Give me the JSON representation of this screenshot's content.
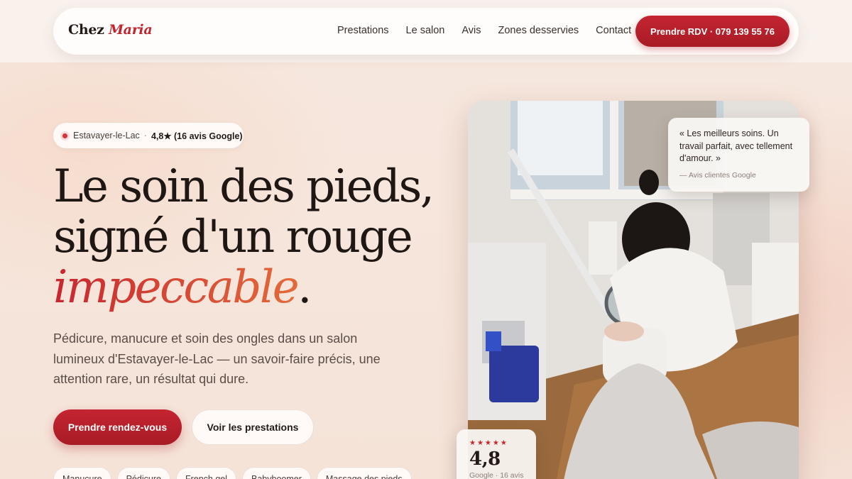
{
  "nav": {
    "brand_prefix": "Chez",
    "brand_name": "Maria",
    "links": [
      "Prestations",
      "Le salon",
      "Avis",
      "Zones desservies",
      "Contact"
    ],
    "cta_label": "Prendre RDV · 079 139 55 76"
  },
  "hero": {
    "badge": {
      "location": "Estavayer-le-Lac",
      "separator": "·",
      "rating": "4,8★ (16 avis Google)"
    },
    "headline_line1": "Le soin des pieds,",
    "headline_line2": "signé d'un rouge",
    "headline_accent": "impeccable",
    "headline_end": ".",
    "lede": "Pédicure, manucure et soin des ongles dans un salon lumineux d'Estavayer-le-Lac — un savoir-faire précis, une attention rare, un résultat qui dure.",
    "primary_label": "Prendre rendez-vous",
    "secondary_label": "Voir les prestations",
    "chips": [
      "Manucure",
      "Pédicure",
      "French gel",
      "Babyboomer",
      "Massage des pieds"
    ]
  },
  "testimonial": {
    "quote": "« Les meilleurs soins. Un travail parfait, avec tellement d'amour. »",
    "source": "— Avis clientes Google"
  },
  "rating_card": {
    "stars": "★★★★★",
    "value": "4,8",
    "subtitle": "Google · 16 avis"
  },
  "colors": {
    "accent": "#c42531",
    "accent_gradient_end": "#e46a3a",
    "background": "#f6e7de",
    "text_dark": "#1f1714"
  }
}
